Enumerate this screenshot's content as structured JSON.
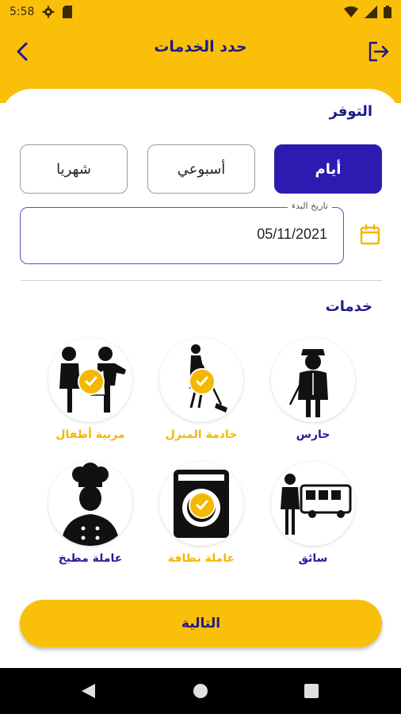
{
  "status": {
    "time": "5:58"
  },
  "header": {
    "title": "حدد الخدمات"
  },
  "availability": {
    "title": "التوفر",
    "periods": [
      {
        "label": "أيام",
        "selected": true
      },
      {
        "label": "أسبوعي",
        "selected": false
      },
      {
        "label": "شهريا",
        "selected": false
      }
    ],
    "start_date_label": "تاريخ البدء",
    "start_date_value": "05/11/2021"
  },
  "services": {
    "title": "خدمات",
    "items": [
      {
        "label": "حارس",
        "selected": false,
        "icon": "guard-icon"
      },
      {
        "label": "خادمة المنزل",
        "selected": true,
        "icon": "housemaid-icon"
      },
      {
        "label": "مربية أطفال",
        "selected": true,
        "icon": "nanny-icon"
      },
      {
        "label": "سائق",
        "selected": false,
        "icon": "driver-icon"
      },
      {
        "label": "عاملة نظافة",
        "selected": true,
        "icon": "cleaner-icon"
      },
      {
        "label": "عاملة مطبخ",
        "selected": false,
        "icon": "cook-icon"
      }
    ]
  },
  "next_button": "التالية",
  "colors": {
    "accent": "#f9bf09",
    "primary": "#2e1ab0",
    "text_blue": "#1f1a8a"
  }
}
